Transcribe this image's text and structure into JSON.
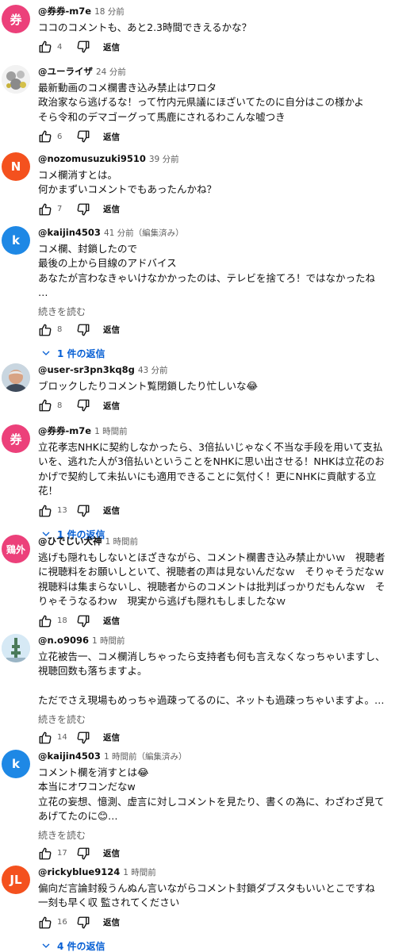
{
  "labels": {
    "reply": "返信",
    "read_more": "続きを読む"
  },
  "colors": {
    "reply_link": "#065fd4"
  },
  "comments": [
    {
      "author": "@券券-m7e",
      "time": "18 分前",
      "avatar_text": "券",
      "avatar_color": "#ec407a",
      "text": "ココのコメントも、あと2.3時間できえるかな？",
      "likes": "4"
    },
    {
      "author": "@ユーライザ",
      "time": "24 分前",
      "avatar_text": "",
      "avatar_color": "#e6e6e6",
      "text": "最新動画のコメ欄書き込み禁止はワロタ\n政治家なら逃げるな！って竹内元県議にほざいてたのに自分はこの様かよ\nそら令和のデマゴーグって馬鹿にされるわこんな嘘つき",
      "likes": "6"
    },
    {
      "author": "@nozomusuzuki9510",
      "time": "39 分前",
      "avatar_text": "N",
      "avatar_color": "#f4511e",
      "text": "コメ欄消すとは。\n何かまずいコメントでもあったんかね？",
      "likes": "7"
    },
    {
      "author": "@kaijin4503",
      "time": "41 分前（編集済み）",
      "avatar_text": "k",
      "avatar_color": "#1e88e5",
      "text": "コメ欄、封鎖したので\n最後の上から目線のアドバイス\nあなたが言わなきゃいけなかかったのは、テレビを捨てろ！ではなかったね\n…",
      "likes": "8",
      "more": true,
      "replies": "1 件の返信"
    },
    {
      "author": "@user-sr3pn3kq8g",
      "time": "43 分前",
      "avatar_text": "",
      "avatar_color": "#8d6e63",
      "text": "ブロックしたりコメント覧閉鎖したり忙しいな😂",
      "likes": "8"
    },
    {
      "author": "@券券-m7e",
      "time": "1 時間前",
      "avatar_text": "券",
      "avatar_color": "#ec407a",
      "text": "立花孝志NHKに契約しなかったら、3倍払いじゃなく不当な手段を用いて支払いを、逃れた人が3倍払いということをNHKに思い出させる！NHKは立花のおかげで契約して未払いにも適用できることに気付く！更にNHKに貢献する立花！",
      "likes": "13",
      "replies": "1 件の返信"
    },
    {
      "author": "@ひでじい犬神",
      "time": "1 時間前",
      "avatar_text": "鶏外",
      "avatar_color": "#ec407a",
      "avatar_small": true,
      "text": "逃げも隠れもしないとほざきながら、コメント欄書き込み禁止かいｗ　視聴者に視聴料をお願いしといて、視聴者の声は見ないんだなｗ　そりゃそうだなｗ　視聴料は集まらないし、視聴者からのコメントは批判ばっかりだもんなｗ　そりゃそうなるわｗ　現実から逃げも隠れもしましたなｗ",
      "likes": "18"
    },
    {
      "author": "@n.o9096",
      "time": "1 時間前",
      "avatar_text": "",
      "avatar_color": "#cfe3f2",
      "text": "立花被告一、コメ欄消しちゃったら支持者も何も言えなくなっちゃいますし、視聴回数も落ちますよ。\n\nただでさえ現場もめっちゃ過疎ってるのに、ネットも過疎っちゃいますよ。…",
      "likes": "14",
      "more": true
    },
    {
      "author": "@kaijin4503",
      "time": "1 時間前（編集済み）",
      "avatar_text": "k",
      "avatar_color": "#1e88e5",
      "text": "コメント欄を消すとは😂\n本当にオワコンだなw\n立花の妄想、憶測、虚言に対しコメントを見たり、書くの為に、わざわざ見てあげてたのに😊…",
      "likes": "17",
      "more": true
    },
    {
      "author": "@rickyblue9124",
      "time": "1 時間前",
      "avatar_text": "JL",
      "avatar_color": "#f4511e",
      "text": "偏向だ言論封殺うんぬん言いながらコメント封鎖ダブスタもいいとこですね\n一刻も早く収 監されてください",
      "likes": "16",
      "replies": "4 件の返信"
    }
  ]
}
